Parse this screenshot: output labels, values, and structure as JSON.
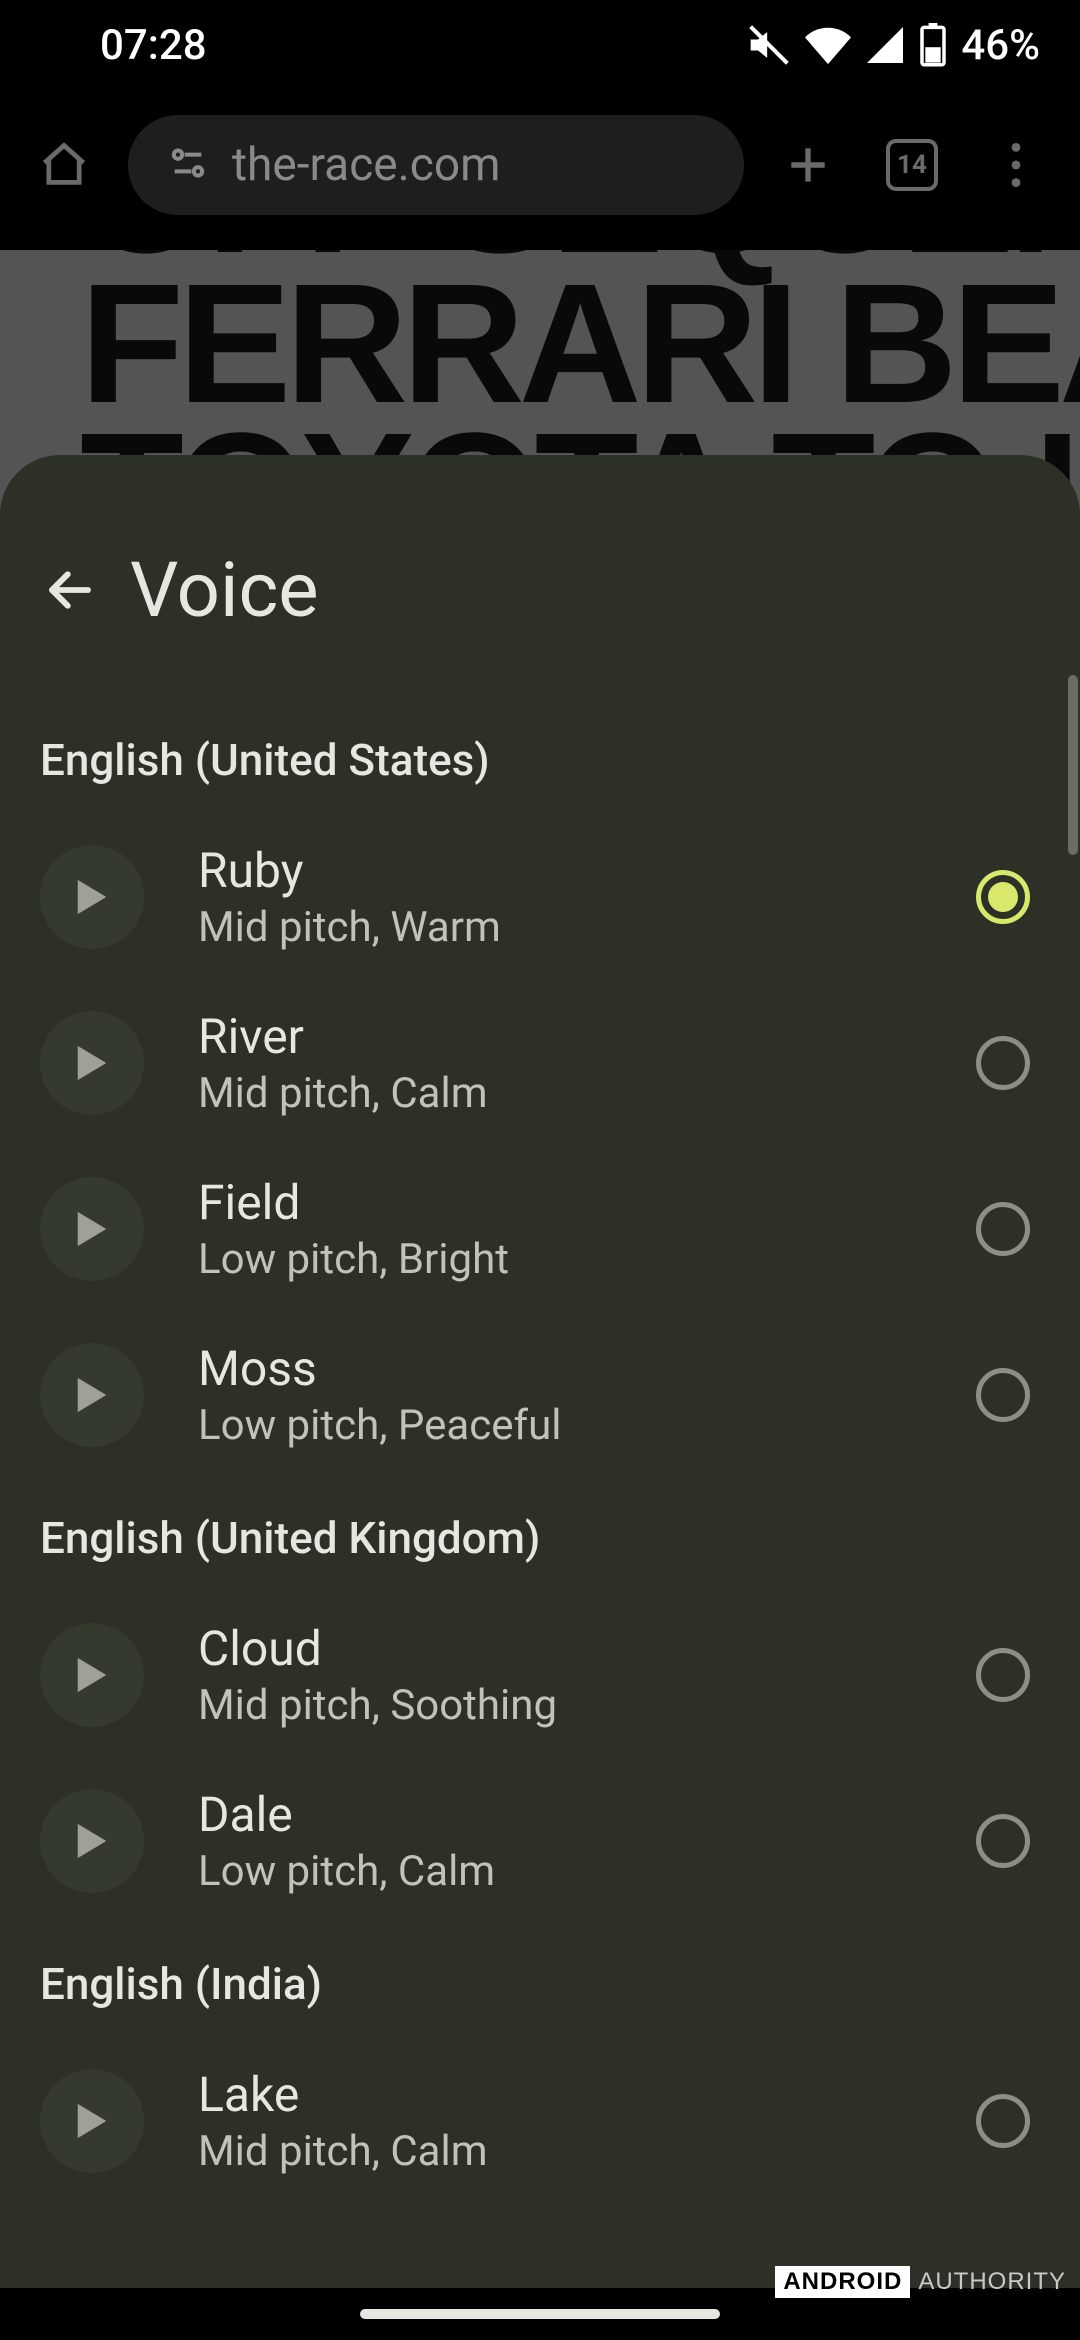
{
  "status_bar": {
    "time": "07:28",
    "battery_percent": "46%"
  },
  "browser": {
    "url": "the-race.com",
    "tab_count": "14",
    "headline_line1": "OFF SEQUENCE",
    "headline_line2": "FERRARI BEATS",
    "headline_line3": "TOYOTA TO LE MANS"
  },
  "sheet": {
    "title": "Voice",
    "sections": [
      {
        "label": "English (United States)",
        "voices": [
          {
            "name": "Ruby",
            "desc": "Mid pitch, Warm",
            "selected": true
          },
          {
            "name": "River",
            "desc": "Mid pitch, Calm",
            "selected": false
          },
          {
            "name": "Field",
            "desc": "Low pitch, Bright",
            "selected": false
          },
          {
            "name": "Moss",
            "desc": "Low pitch, Peaceful",
            "selected": false
          }
        ]
      },
      {
        "label": "English (United Kingdom)",
        "voices": [
          {
            "name": "Cloud",
            "desc": "Mid pitch, Soothing",
            "selected": false
          },
          {
            "name": "Dale",
            "desc": "Low pitch, Calm",
            "selected": false
          }
        ]
      },
      {
        "label": "English (India)",
        "voices": [
          {
            "name": "Lake",
            "desc": "Mid pitch, Calm",
            "selected": false
          }
        ]
      }
    ]
  },
  "watermark": {
    "part1": "ANDROID",
    "part2": "AUTHORITY"
  }
}
